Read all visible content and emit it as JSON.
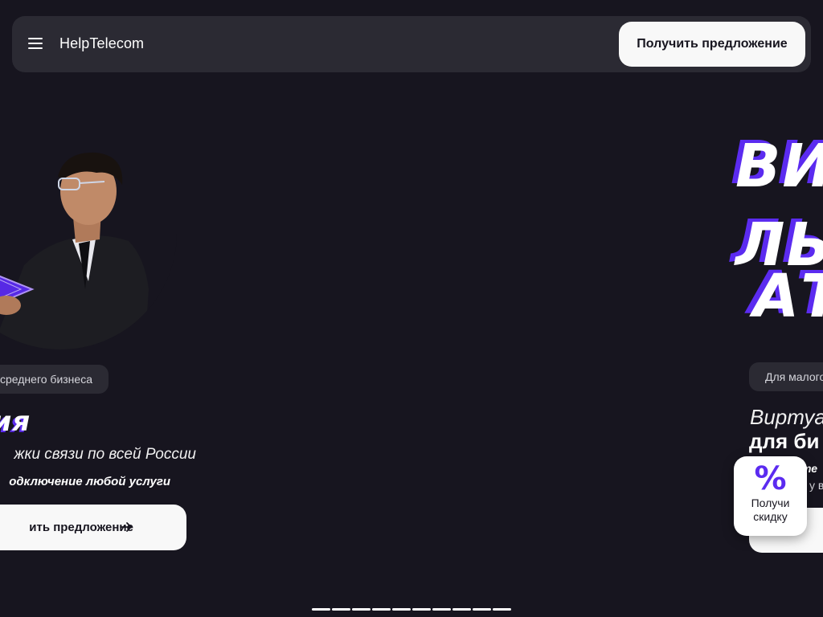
{
  "header": {
    "logo": "HelpTelecom",
    "menu_icon": "hamburger-menu-icon",
    "cta_label": "Получить предложение"
  },
  "slide_left": {
    "tag": "среднего бизнеса",
    "title": "альные решения",
    "subtitle": "жки связи по всей России",
    "bold_line": "одключение любой услуги",
    "cta_label": "ить предложение",
    "cta_icon": "arrow-right-icon",
    "image": "businessman-with-neon-star"
  },
  "slide_right": {
    "big_lines": [
      "ВИ",
      "ЛЬ",
      "АТ"
    ],
    "tag": "Для малого",
    "title_line1": "Виртуа",
    "title_line2": "для би",
    "small_line1": "те",
    "small_line2": "у в"
  },
  "discount_widget": {
    "icon": "percent-icon",
    "symbol": "%",
    "label": "Получи скидку"
  },
  "pager": {
    "count": 10
  },
  "colors": {
    "background": "#17151f",
    "header_bg": "#2b2a33",
    "accent": "#5b2bf0",
    "button_bg": "#f8f8f8"
  }
}
